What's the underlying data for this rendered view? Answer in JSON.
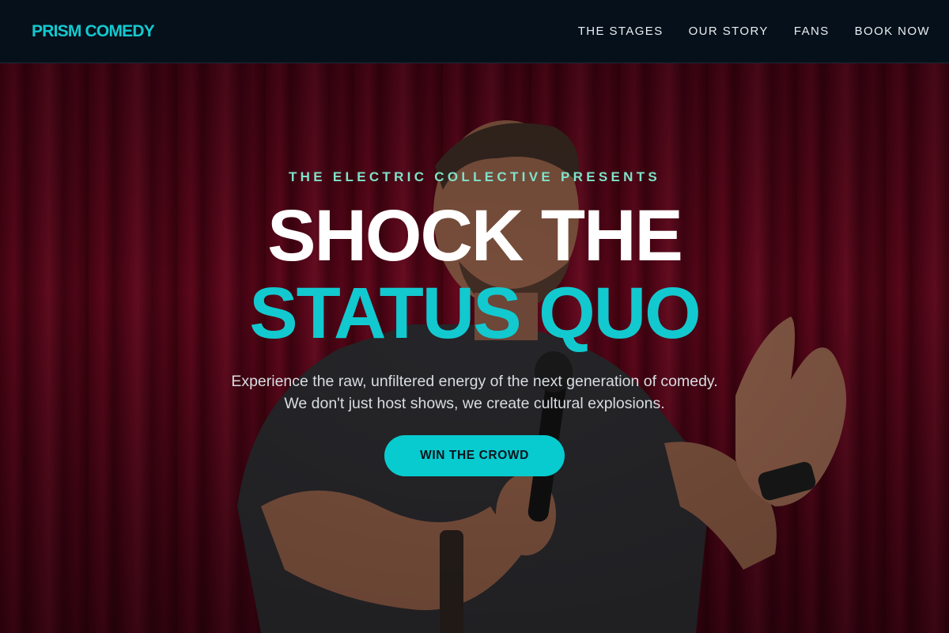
{
  "nav": {
    "logo": "PRISM COMEDY",
    "links": [
      "THE STAGES",
      "OUR STORY",
      "FANS",
      "BOOK NOW"
    ]
  },
  "hero": {
    "eyebrow": "THE ELECTRIC COLLECTIVE PRESENTS",
    "headline_line1": "SHOCK THE",
    "headline_line2": "STATUS QUO",
    "subtext": "Experience the raw, unfiltered energy of the next generation of comedy. We don't just host shows, we create cultural explosions.",
    "cta_label": "WIN THE CROWD",
    "background_image": "comedian-on-stage-photo"
  },
  "colors": {
    "accent": "#12c9cf",
    "eyebrow": "#7fe3c9",
    "nav_background": "#06101a",
    "curtain": "#6d0820"
  }
}
